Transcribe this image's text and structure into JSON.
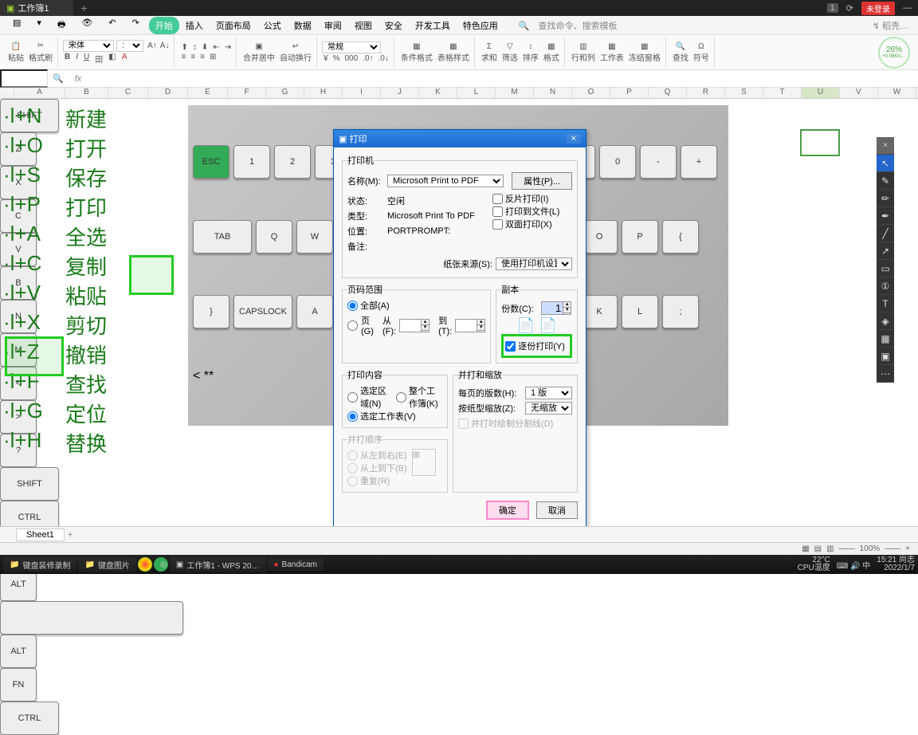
{
  "titlebar": {
    "tab": "工作簿1",
    "plus": "+",
    "box": "1",
    "login": "未登录"
  },
  "menus": {
    "start": "开始",
    "items": [
      "插入",
      "页面布局",
      "公式",
      "数据",
      "审阅",
      "视图",
      "安全",
      "开发工具",
      "特色应用"
    ],
    "search_ph": "查找命令、搜索模板",
    "wrench": "↯ 稻壳…"
  },
  "ribbon": {
    "paste": "粘贴",
    "fmt": "格式刷",
    "font": "宋体",
    "size": "11",
    "cond": "常规",
    "merge": "合并居中",
    "wrap": "自动换行",
    "condf": "条件格式",
    "tblstyle": "表格样式",
    "sum": "求和",
    "filter": "筛选",
    "sort": "排序",
    "fmt2": "格式",
    "rowcol": "行和列",
    "wksht": "工作表",
    "freeze": "冻结窗格",
    "find": "查找",
    "sym": "符号",
    "perf": "26%",
    "perf2": "+0.08K/s…"
  },
  "fbar": {
    "fx": "fx"
  },
  "cols": [
    "A",
    "B",
    "C",
    "D",
    "E",
    "F",
    "G",
    "H",
    "I",
    "J",
    "K",
    "L",
    "M",
    "N",
    "O",
    "P",
    "Q",
    "R",
    "S",
    "T",
    "U",
    "V",
    "W"
  ],
  "shortcuts": [
    {
      "k": "·l+N",
      "t": "新建"
    },
    {
      "k": "·l+O",
      "t": "打开"
    },
    {
      "k": "·l+S",
      "t": "保存"
    },
    {
      "k": "·l+P",
      "t": "打印"
    },
    {
      "k": "·l+A",
      "t": "全选"
    },
    {
      "k": "·l+C",
      "t": "复制"
    },
    {
      "k": "·l+V",
      "t": "粘贴"
    },
    {
      "k": "·l+X",
      "t": "剪切"
    },
    {
      "k": "·l+Z",
      "t": "撤销"
    },
    {
      "k": "·l+F",
      "t": "查找"
    },
    {
      "k": "·l+G",
      "t": "定位"
    },
    {
      "k": "·l+H",
      "t": "替换"
    }
  ],
  "dlg": {
    "title": "打印",
    "close": "×",
    "printer": "打印机",
    "name": "名称(M):",
    "name_v": "Microsoft Print to PDF",
    "props": "属性(P)...",
    "status": "状态:",
    "status_v": "空闲",
    "type": "类型:",
    "type_v": "Microsoft Print To PDF",
    "where": "位置:",
    "where_v": "PORTPROMPT:",
    "comment": "备注:",
    "invert": "反片打印(I)",
    "tofile": "打印到文件(L)",
    "duplex": "双面打印(X)",
    "papersrc": "纸张来源(S):",
    "papersrc_v": "使用打印机设置",
    "range": "页码范围",
    "all": "全部(A)",
    "pages": "页(G)",
    "from": "从(F):",
    "to": "到(T):",
    "copies": "副本",
    "ncopies": "份数(C):",
    "ncopies_v": "1",
    "collate": "逐份打印(Y)",
    "content": "打印内容",
    "selarea": "选定区域(N)",
    "wholewb": "整个工作簿(K)",
    "selsheet": "选定工作表(V)",
    "order": "并打顺序",
    "l2r": "从左到右(E)",
    "t2b": "从上到下(B)",
    "repeat": "重复(R)",
    "shrink": "并打和缩放",
    "perpage": "每页的版数(H):",
    "perpage_v": "1 版",
    "scale": "按纸型缩放(Z):",
    "scale_v": "无缩放",
    "drawline": "并打时绘制分割线(D)",
    "ok": "确定",
    "cancel": "取消"
  },
  "tabs": {
    "sheet": "Sheet1",
    "add": "+"
  },
  "status": {
    "zoom": "100%"
  },
  "task": {
    "t1": "键盘装修录制",
    "t2": "键盘图片",
    "t3": "工作簿1 - WPS 20…",
    "t4": "Bandicam",
    "temp": "22°C",
    "cpu": "CPU温度",
    "input": "⌨ 🔊 中",
    "time": "15:21 尚志",
    "date": "2022/1/7"
  }
}
